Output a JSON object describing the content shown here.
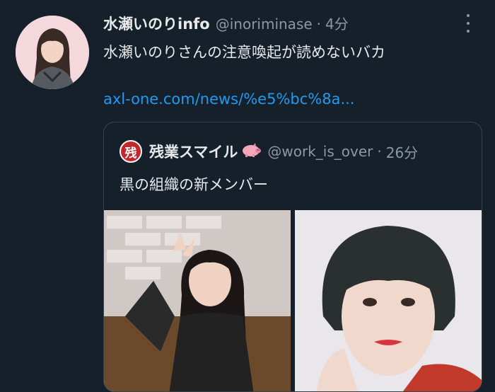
{
  "tweet": {
    "display_name": "水瀬いのりinfo",
    "handle": "@inoriminase",
    "separator": "·",
    "time": "4分",
    "text": "水瀬いのりさんの注意喚起が読めないバカ",
    "link": "axl-one.com/news/%e5%bc%8a..."
  },
  "quoted": {
    "avatar_glyph": "残",
    "display_name": "残業スマイル",
    "handle": "@work_is_over",
    "separator": "·",
    "time": "26分",
    "text": "黒の組織の新メンバー"
  },
  "icons": {
    "more": "more-vertical-icon",
    "pig": "pig-emoji-icon"
  },
  "colors": {
    "background": "#15202b",
    "text": "#e7e9ea",
    "secondary": "#8b98a5",
    "link": "#1d9bf0",
    "border": "#38444d"
  }
}
